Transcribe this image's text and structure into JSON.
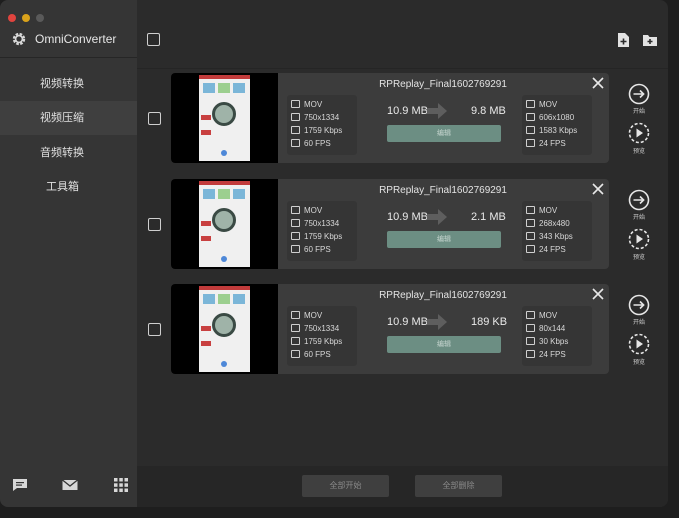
{
  "app": {
    "name": "OmniConverter"
  },
  "sidebar": {
    "items": [
      {
        "label": "视频转换",
        "active": false
      },
      {
        "label": "视频压缩",
        "active": true
      },
      {
        "label": "音频转换",
        "active": false
      },
      {
        "label": "工具箱",
        "active": false
      }
    ],
    "bottom_icons": [
      "chat-icon",
      "mail-icon",
      "grid-icon"
    ]
  },
  "toolbar": {
    "icons": [
      "add-file-icon",
      "add-folder-icon"
    ]
  },
  "tasks": [
    {
      "filename": "RPReplay_Final1602769291",
      "input": {
        "format": "MOV",
        "resolution": "750x1334",
        "bitrate": "1759 Kbps",
        "fps": "60 FPS",
        "size": "10.9 MB"
      },
      "output": {
        "format": "MOV",
        "resolution": "606x1080",
        "bitrate": "1583 Kbps",
        "fps": "24 FPS",
        "size": "9.8 MB"
      },
      "edit_label": "编辑",
      "start_label": "开始",
      "preview_label": "预览"
    },
    {
      "filename": "RPReplay_Final1602769291",
      "input": {
        "format": "MOV",
        "resolution": "750x1334",
        "bitrate": "1759 Kbps",
        "fps": "60 FPS",
        "size": "10.9 MB"
      },
      "output": {
        "format": "MOV",
        "resolution": "268x480",
        "bitrate": "343 Kbps",
        "fps": "24 FPS",
        "size": "2.1 MB"
      },
      "edit_label": "编辑",
      "start_label": "开始",
      "preview_label": "预览"
    },
    {
      "filename": "RPReplay_Final1602769291",
      "input": {
        "format": "MOV",
        "resolution": "750x1334",
        "bitrate": "1759 Kbps",
        "fps": "60 FPS",
        "size": "10.9 MB"
      },
      "output": {
        "format": "MOV",
        "resolution": "80x144",
        "bitrate": "30 Kbps",
        "fps": "24 FPS",
        "size": "189 KB"
      },
      "edit_label": "编辑",
      "start_label": "开始",
      "preview_label": "预览"
    }
  ],
  "footer": {
    "start_all_label": "全部开始",
    "delete_all_label": "全部删除"
  },
  "colors": {
    "edit_button": "#6c8e83",
    "sidebar": "#353535",
    "background": "#2b2b2b"
  }
}
